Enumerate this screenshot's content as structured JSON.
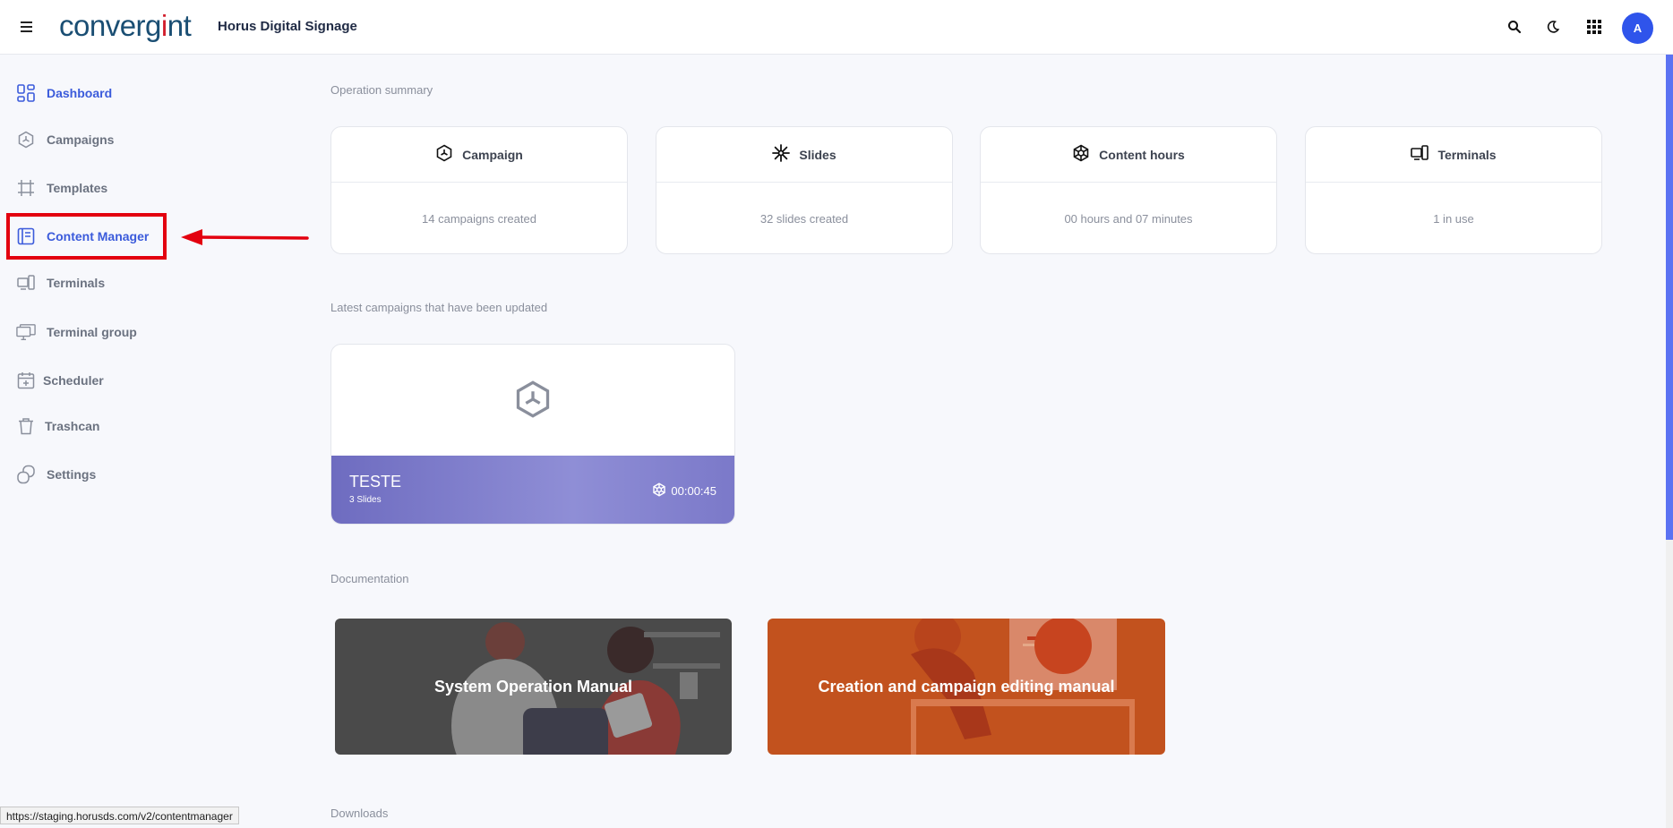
{
  "header": {
    "logo_text_a": "converg",
    "logo_text_dot": "i",
    "logo_text_b": "nt",
    "app_title": "Horus Digital Signage",
    "avatar_letter": "A",
    "icons": [
      "search-icon",
      "moon-icon",
      "apps-grid-icon"
    ]
  },
  "sidebar": {
    "items": [
      {
        "label": "Dashboard",
        "icon": "dashboard-icon",
        "active": true
      },
      {
        "label": "Campaigns",
        "icon": "campaign-hex-icon"
      },
      {
        "label": "Templates",
        "icon": "crop-frame-icon"
      },
      {
        "label": "Content Manager",
        "icon": "document-list-icon",
        "highlighted": true
      },
      {
        "label": "Terminals",
        "icon": "devices-icon"
      },
      {
        "label": "Terminal group",
        "icon": "monitors-icon"
      },
      {
        "label": "Scheduler",
        "icon": "calendar-plus-icon"
      },
      {
        "label": "Trashcan",
        "icon": "trash-icon"
      },
      {
        "label": "Settings",
        "icon": "layers-icon"
      }
    ],
    "highlight_color": "#e3000f"
  },
  "main": {
    "operation_summary_label": "Operation summary",
    "stats": [
      {
        "title": "Campaign",
        "value": "14 campaigns created",
        "icon": "campaign-hex-icon"
      },
      {
        "title": "Slides",
        "value": "32 slides created",
        "icon": "asterisk-icon"
      },
      {
        "title": "Content hours",
        "value": "00 hours and 07 minutes",
        "icon": "clock-flower-icon"
      },
      {
        "title": "Terminals",
        "value": "1 in use",
        "icon": "devices-icon"
      }
    ],
    "latest_label": "Latest campaigns that have been updated",
    "campaign": {
      "name": "TESTE",
      "slides": "3 Slides",
      "duration": "00:00:45"
    },
    "documentation_label": "Documentation",
    "docs": [
      {
        "title": "System Operation Manual"
      },
      {
        "title": "Creation and campaign editing manual"
      }
    ],
    "downloads_label": "Downloads"
  },
  "status_bar": {
    "url": "https://staging.horusds.com/v2/contentmanager"
  },
  "colors": {
    "accent": "#3b5bdb",
    "brand": "#1a4e73",
    "avatar": "#2f54eb"
  }
}
